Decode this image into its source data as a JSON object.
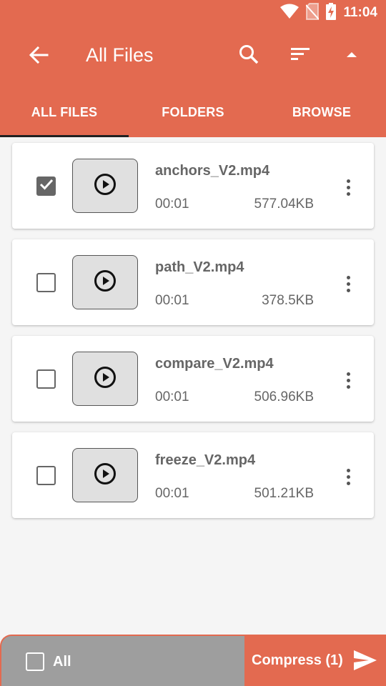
{
  "status_bar": {
    "time": "11:04",
    "icons": [
      "wifi-icon",
      "no-sim-icon",
      "battery-charging-icon"
    ]
  },
  "toolbar": {
    "title": "All Files",
    "icons": [
      "back-arrow-icon",
      "search-icon",
      "sort-icon",
      "arrow-up-icon"
    ]
  },
  "tabs": [
    {
      "label": "ALL FILES",
      "active": true
    },
    {
      "label": "FOLDERS",
      "active": false
    },
    {
      "label": "BROWSE",
      "active": false
    }
  ],
  "files": [
    {
      "name": "anchors_V2.mp4",
      "duration": "00:01",
      "size": "577.04KB",
      "checked": true
    },
    {
      "name": "path_V2.mp4",
      "duration": "00:01",
      "size": "378.5KB",
      "checked": false
    },
    {
      "name": "compare_V2.mp4",
      "duration": "00:01",
      "size": "506.96KB",
      "checked": false
    },
    {
      "name": "freeze_V2.mp4",
      "duration": "00:01",
      "size": "501.21KB",
      "checked": false
    }
  ],
  "bottom_bar": {
    "select_all_label": "All",
    "compress_label": "Compress (1)"
  },
  "colors": {
    "accent": "#e36a50",
    "bottom_left_bg": "#9e9e9e",
    "text_gray": "#666666"
  }
}
